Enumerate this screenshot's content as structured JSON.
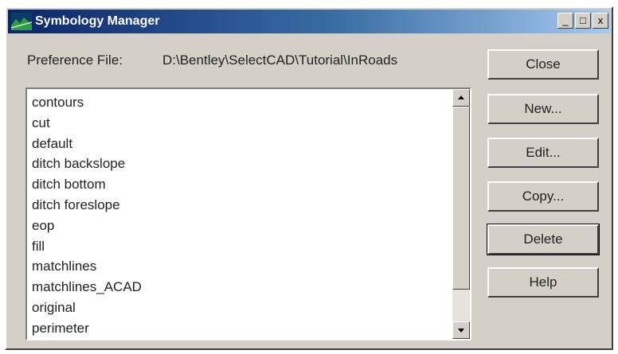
{
  "window": {
    "title": "Symbology Manager",
    "controls": {
      "minimize": "_",
      "maximize": "□",
      "close": "x"
    }
  },
  "preference": {
    "label": "Preference File:",
    "value": "D:\\Bentley\\SelectCAD\\Tutorial\\InRoads"
  },
  "list": {
    "items": [
      "contours",
      "cut",
      "default",
      "ditch backslope",
      "ditch bottom",
      "ditch foreslope",
      "eop",
      "fill",
      "matchlines",
      "matchlines_ACAD",
      "original",
      "perimeter"
    ]
  },
  "buttons": {
    "close": "Close",
    "new": "New...",
    "edit": "Edit...",
    "copy": "Copy...",
    "delete": "Delete",
    "help": "Help"
  },
  "colors": {
    "title_gradient_start": "#0a246a",
    "title_gradient_end": "#a6caf0",
    "face": "#d4d0c8"
  }
}
